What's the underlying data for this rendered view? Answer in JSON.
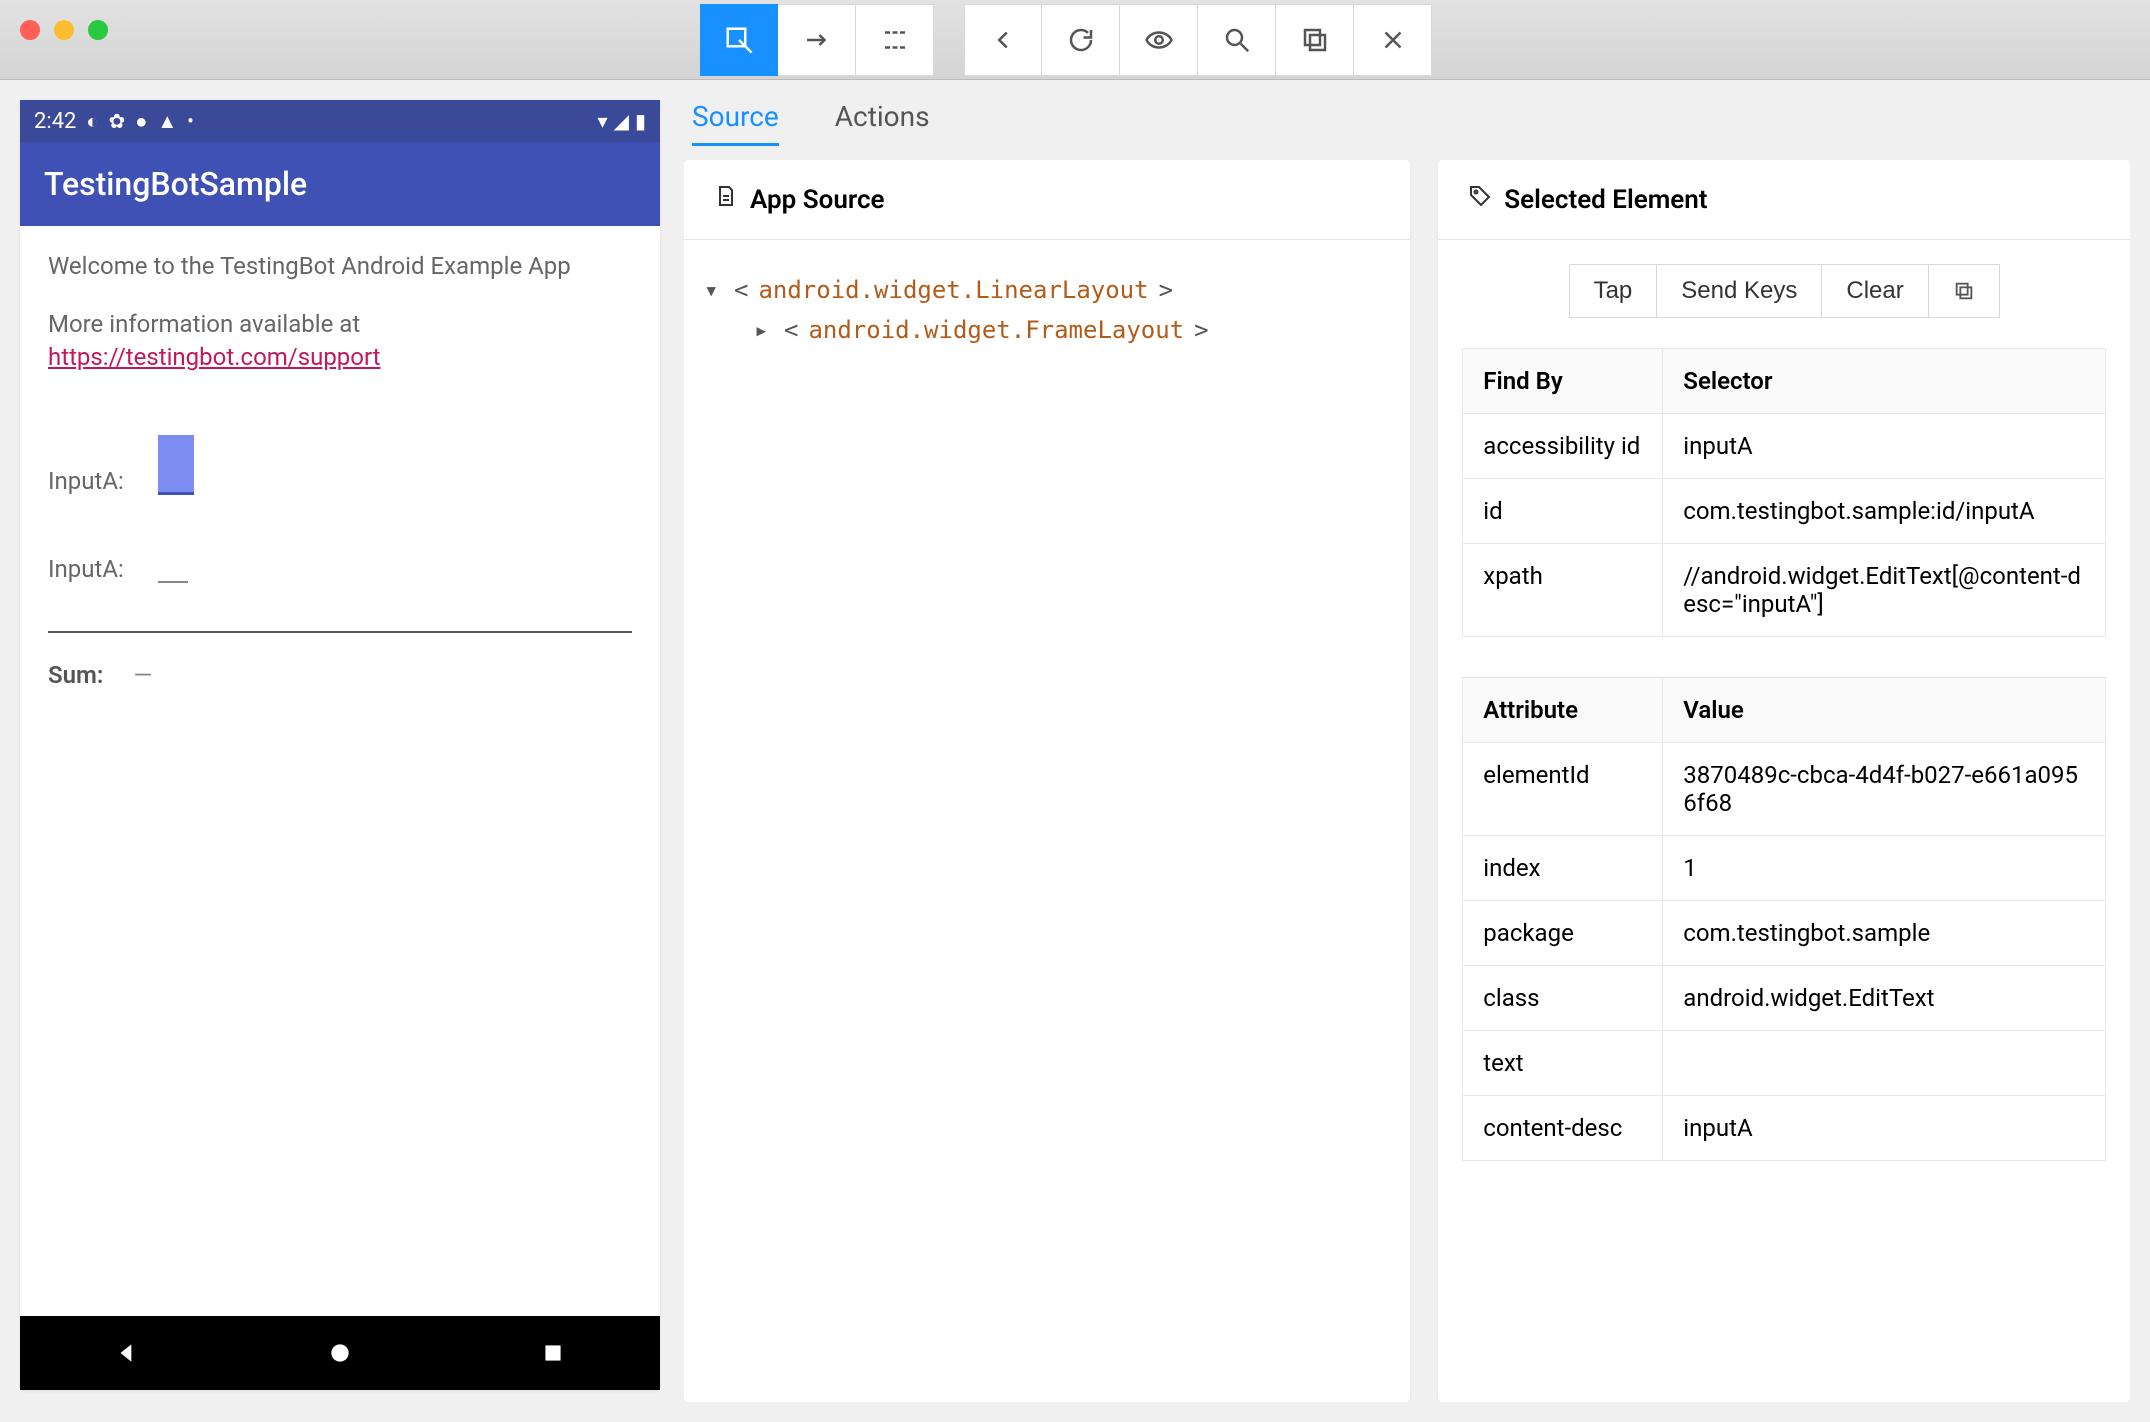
{
  "titlebar": {
    "traffic_close": "close",
    "traffic_min": "minimize",
    "traffic_max": "maximize"
  },
  "toolbar": {
    "select_element": "Select Element",
    "swipe": "Swipe",
    "tap_coords": "Tap By Coordinates",
    "back": "Back",
    "refresh": "Refresh",
    "record": "Toggle Recording",
    "search": "Search",
    "copy_xml": "Copy XML",
    "quit": "Quit"
  },
  "device": {
    "time": "2:42",
    "app_title": "TestingBotSample",
    "welcome": "Welcome to the TestingBot Android Example App",
    "more_info_prefix": "More information available at ",
    "more_info_link": "https://testingbot.com/support",
    "labelA": "InputA:",
    "labelB": "InputA:",
    "sum_label": "Sum:",
    "sum_value": "—"
  },
  "tabs": {
    "source": "Source",
    "actions": "Actions"
  },
  "source_panel": {
    "title": "App Source",
    "tree": [
      {
        "tag": "android.widget.LinearLayout",
        "expanded": true
      },
      {
        "tag": "android.widget.FrameLayout",
        "expanded": false
      }
    ]
  },
  "selected_panel": {
    "title": "Selected Element",
    "actions": {
      "tap": "Tap",
      "send_keys": "Send Keys",
      "clear": "Clear",
      "copy": "Copy"
    },
    "findby_header": {
      "col1": "Find By",
      "col2": "Selector"
    },
    "findby": [
      {
        "by": "accessibility id",
        "selector": "inputA"
      },
      {
        "by": "id",
        "selector": "com.testingbot.sample:id/inputA"
      },
      {
        "by": "xpath",
        "selector": "//android.widget.EditText[@content-desc=\"inputA\"]"
      }
    ],
    "attr_header": {
      "col1": "Attribute",
      "col2": "Value"
    },
    "attrs": [
      {
        "name": "elementId",
        "value": "3870489c-cbca-4d4f-b027-e661a0956f68"
      },
      {
        "name": "index",
        "value": "1"
      },
      {
        "name": "package",
        "value": "com.testingbot.sample"
      },
      {
        "name": "class",
        "value": "android.widget.EditText"
      },
      {
        "name": "text",
        "value": ""
      },
      {
        "name": "content-desc",
        "value": "inputA"
      }
    ]
  }
}
